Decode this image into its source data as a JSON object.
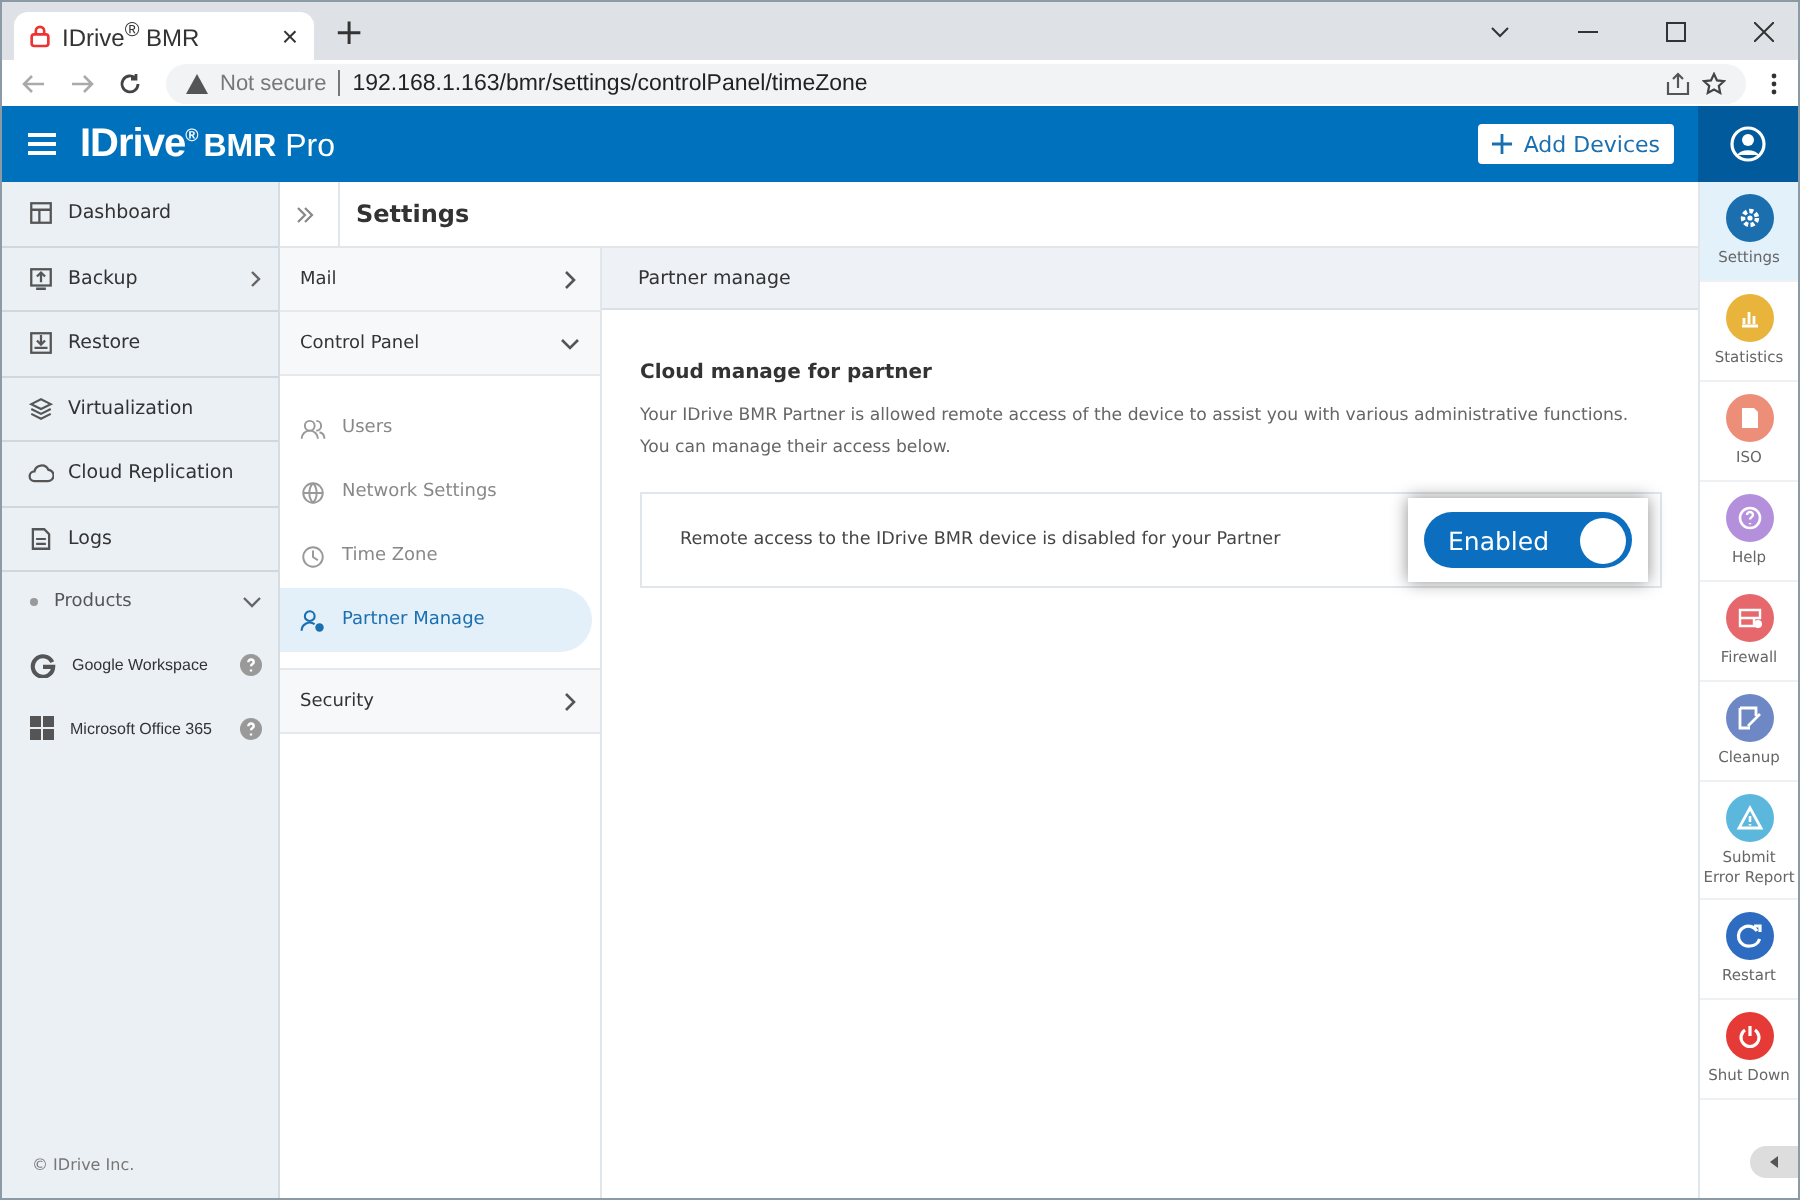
{
  "browser": {
    "tab_title": "IDrive$^{®}$ BMR",
    "tab_close": "×",
    "new_tab": "+",
    "security": "Not secure",
    "url": "192.168.1.163/bmr/settings/controlPanel/timeZone"
  },
  "header": {
    "logo_brand": "IDrive$^{®}$",
    "logo_product": "**BMR** Pro",
    "add_button": "Add Devices"
  },
  "nav": {
    "items": [
      {
        "label": "Dashboard",
        "chevron": false
      },
      {
        "label": "Backup",
        "chevron": true
      },
      {
        "label": "Restore",
        "chevron": false
      },
      {
        "label": "Virtualization",
        "chevron": false
      },
      {
        "label": "Cloud Replication",
        "chevron": false
      },
      {
        "label": "Logs",
        "chevron": false
      }
    ],
    "products": {
      "label": "Products",
      "expanded": true,
      "items": [
        {
          "label": "Google Workspace"
        },
        {
          "label": "Microsoft Office 365"
        }
      ]
    },
    "footer": "© IDrive Inc."
  },
  "settings": {
    "title": "Settings",
    "sections": [
      {
        "label": "Mail",
        "expanded": false
      },
      {
        "label": "Control Panel",
        "expanded": true,
        "children": [
          {
            "label": "Users",
            "selected": false
          },
          {
            "label": "Network Settings",
            "selected": false
          },
          {
            "label": "Time Zone",
            "selected": false
          },
          {
            "label": "Partner Manage",
            "selected": true
          }
        ]
      },
      {
        "label": "Security",
        "expanded": false
      }
    ]
  },
  "content": {
    "header": "Partner manage",
    "heading": "Cloud manage for partner",
    "description": "Your IDrive BMR Partner is allowed remote access of the device to assist you with various administrative functions. You can manage their access below.",
    "row_text": "Remote access to the IDrive BMR device is disabled for your Partner",
    "toggle": {
      "label": "Enabled",
      "on": true
    }
  },
  "rail": [
    {
      "label": "Settings",
      "color": "#1b6fae",
      "selected": true
    },
    {
      "label": "Statistics",
      "color": "#e9b43c",
      "selected": false
    },
    {
      "label": "ISO",
      "color": "#ec8e78",
      "selected": false
    },
    {
      "label": "Help",
      "color": "#b48fdc",
      "selected": false
    },
    {
      "label": "Firewall",
      "color": "#e6686c",
      "selected": false
    },
    {
      "label": "Cleanup",
      "color": "#6d88c4",
      "selected": false
    },
    {
      "label": "Submit Error Report",
      "color": "#5cb7dc",
      "selected": false
    },
    {
      "label": "Restart",
      "color": "#2e6cc1",
      "selected": false
    },
    {
      "label": "Shut Down",
      "color": "#e53a35",
      "selected": false
    }
  ]
}
